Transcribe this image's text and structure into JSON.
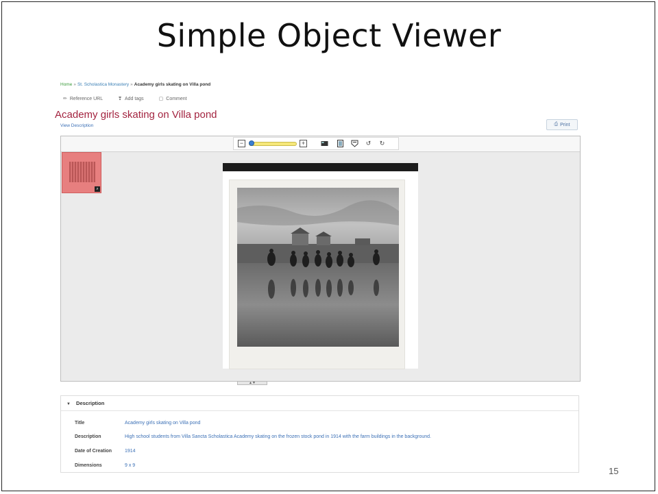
{
  "slide": {
    "title": "Simple Object Viewer",
    "page_number": "15"
  },
  "breadcrumb": {
    "items": [
      "Home",
      "St. Scholastica Monastery",
      "Academy girls skating on Villa pond"
    ],
    "separator": "»"
  },
  "actions": {
    "reference_url": "Reference URL",
    "add_tags": "Add tags",
    "comment": "Comment"
  },
  "object": {
    "title": "Academy girls skating on Villa pond",
    "view_description": "View Description",
    "print": "Print"
  },
  "viewer": {
    "zoom_level": 0.3,
    "zoom_out_icon": "minus-box-icon",
    "zoom_in_icon": "plus-box-icon"
  },
  "description": {
    "header": "Description",
    "rows": [
      {
        "label": "Title",
        "value": "Academy girls skating on Villa pond"
      },
      {
        "label": "Description",
        "value": "High school students from Villa Sancta Scholastica Academy skating on the frozen stock pond in 1914 with the farm buildings in the background."
      },
      {
        "label": "Date of Creation",
        "value": "1914"
      },
      {
        "label": "Dimensions",
        "value": "9 x 9"
      }
    ]
  },
  "colors": {
    "title_red": "#a3233f",
    "link_blue": "#3a6fb5",
    "breadcrumb_green": "#3a7fb5",
    "thumb_highlight": "#e77f7f"
  }
}
